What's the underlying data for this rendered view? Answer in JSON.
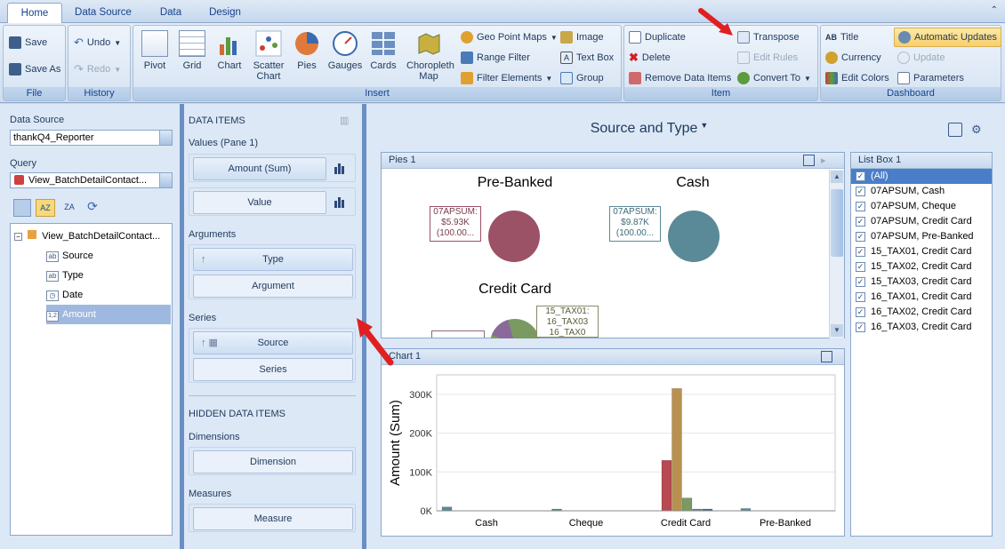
{
  "tabs": [
    {
      "label": "Home"
    },
    {
      "label": "Data Source"
    },
    {
      "label": "Data"
    },
    {
      "label": "Design"
    }
  ],
  "file_group": {
    "label": "File",
    "save": "Save",
    "save_as": "Save As"
  },
  "history_group": {
    "label": "History",
    "undo": "Undo",
    "redo": "Redo"
  },
  "insert_group": {
    "label": "Insert",
    "pivot": "Pivot",
    "grid": "Grid",
    "chart": "Chart",
    "scatter": "Scatter Chart",
    "pies": "Pies",
    "gauges": "Gauges",
    "cards": "Cards",
    "choropleth": "Choropleth Map",
    "geo_point_maps": "Geo Point Maps",
    "range_filter": "Range Filter",
    "filter_elements": "Filter Elements",
    "image": "Image",
    "text_box": "Text Box",
    "group": "Group"
  },
  "item_group": {
    "label": "Item",
    "duplicate": "Duplicate",
    "delete": "Delete",
    "remove_data_items": "Remove Data Items",
    "transpose": "Transpose",
    "edit_rules": "Edit Rules",
    "convert_to": "Convert To"
  },
  "dashboard_group": {
    "label": "Dashboard",
    "title": "Title",
    "currency": "Currency",
    "edit_colors": "Edit Colors",
    "automatic_updates": "Automatic Updates",
    "update": "Update",
    "parameters": "Parameters"
  },
  "datasource_panel": {
    "ds_label": "Data Source",
    "ds_value": "thankQ4_Reporter",
    "query_label": "Query",
    "query_value": "View_BatchDetailContact...",
    "tree_root": "View_BatchDetailContact...",
    "fields": [
      {
        "name": "Source",
        "type": "ab"
      },
      {
        "name": "Type",
        "type": "ab"
      },
      {
        "name": "Date",
        "type": "date"
      },
      {
        "name": "Amount",
        "type": "num"
      }
    ]
  },
  "data_items": {
    "title": "DATA ITEMS",
    "values_label": "Values (Pane 1)",
    "values": [
      "Amount (Sum)",
      "Value"
    ],
    "arguments_label": "Arguments",
    "arguments": [
      "Type",
      "Argument"
    ],
    "series_label": "Series",
    "series": [
      "Source",
      "Series"
    ],
    "hidden_title": "HIDDEN DATA ITEMS",
    "dimensions_label": "Dimensions",
    "dimension": "Dimension",
    "measures_label": "Measures",
    "measure": "Measure"
  },
  "dashboard_title": "Source and Type",
  "pies_panel": {
    "title": "Pies 1",
    "pies": [
      {
        "title": "Pre-Banked",
        "tooltip": [
          "07APSUM:",
          "$5.93K",
          "(100.00..."
        ],
        "color": "#9b5166"
      },
      {
        "title": "Cash",
        "tooltip": [
          "07APSUM:",
          "$9.87K",
          "(100.00..."
        ],
        "color": "#5a8a97"
      },
      {
        "title": "Credit Card",
        "tooltip": [
          "15_TAX01:",
          "16_TAX03",
          "16_TAX0"
        ],
        "color": "#7a9a62"
      }
    ]
  },
  "list_box": {
    "title": "List Box 1",
    "items": [
      "(All)",
      "07APSUM, Cash",
      "07APSUM, Cheque",
      "07APSUM, Credit Card",
      "07APSUM, Pre-Banked",
      "15_TAX01, Credit Card",
      "15_TAX02, Credit Card",
      "15_TAX03, Credit Card",
      "16_TAX01, Credit Card",
      "16_TAX02, Credit Card",
      "16_TAX03, Credit Card"
    ]
  },
  "chart_panel": {
    "title": "Chart 1"
  },
  "chart_data": {
    "type": "bar",
    "categories": [
      "Cash",
      "Cheque",
      "Credit Card",
      "Pre-Banked"
    ],
    "ylabel": "Amount (Sum)",
    "ylim": [
      0,
      350000
    ],
    "yticks": [
      {
        "value": 0,
        "label": "0K"
      },
      {
        "value": 100000,
        "label": "100K"
      },
      {
        "value": 200000,
        "label": "200K"
      },
      {
        "value": 300000,
        "label": "300K"
      }
    ],
    "series": [
      {
        "values": [
          9870,
          0,
          0,
          5930
        ],
        "color": "#5a8a97"
      },
      {
        "values": [
          0,
          2500,
          0,
          0
        ],
        "color": "#5a8a97"
      },
      {
        "values": [
          0,
          0,
          130000,
          0
        ],
        "color": "#b84a52"
      },
      {
        "values": [
          0,
          0,
          315000,
          0
        ],
        "color": "#b89050"
      },
      {
        "values": [
          0,
          0,
          33000,
          0
        ],
        "color": "#7a9a62"
      },
      {
        "values": [
          0,
          0,
          3000,
          0
        ],
        "color": "#5a8a97"
      },
      {
        "values": [
          0,
          0,
          2500,
          0
        ],
        "color": "#4a6a8a"
      }
    ]
  }
}
